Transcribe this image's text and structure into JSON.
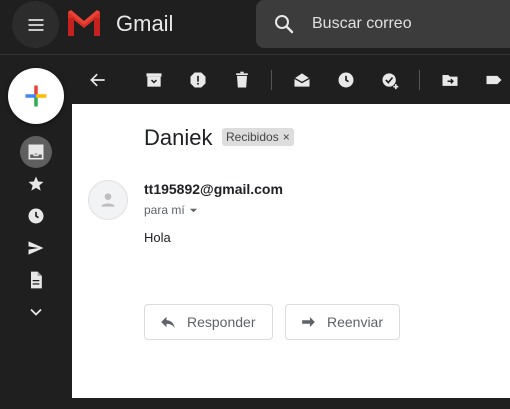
{
  "app": {
    "brand": "Gmail"
  },
  "search": {
    "placeholder": "Buscar correo"
  },
  "message": {
    "subject": "Daniek",
    "label": "Recibidos",
    "label_close": "×",
    "sender_email": "tt195892@gmail.com",
    "to_line": "para mí",
    "body": "Hola"
  },
  "actions": {
    "reply_label": "Responder",
    "forward_label": "Reenviar"
  },
  "colors": {
    "dark_bg": "#1f1f1f",
    "search_bg": "#3c3c3c",
    "active_rail": "#5f5f5f"
  }
}
